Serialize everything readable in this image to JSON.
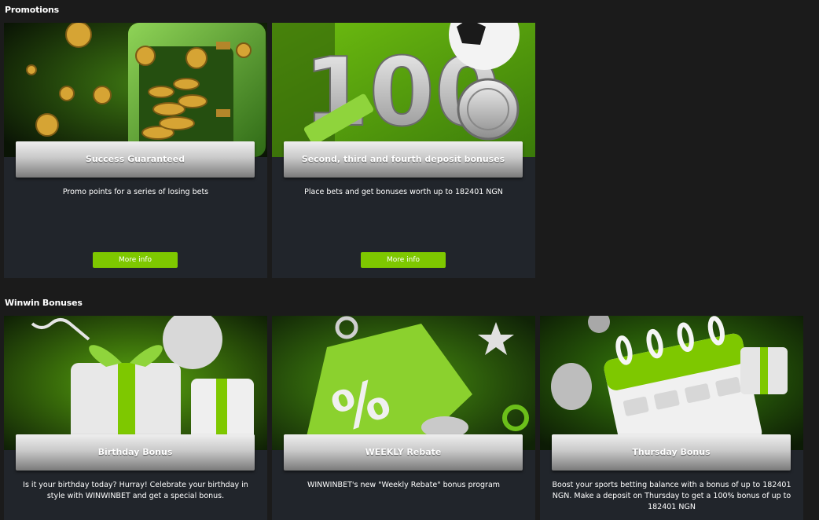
{
  "promotions": {
    "title": "Promotions",
    "cards": [
      {
        "title": "Success Guaranteed",
        "description": "Promo points for a series of losing bets",
        "button": "More info"
      },
      {
        "title": "Second, third and fourth deposit bonuses",
        "description": "Place bets and get bonuses worth up to 182401 NGN",
        "button": "More info"
      }
    ]
  },
  "bonuses": {
    "title": "Winwin Bonuses",
    "cards": [
      {
        "title": "Birthday Bonus",
        "description": "Is it your birthday today? Hurray! Celebrate your birthday in style with WINWINBET and get a special bonus."
      },
      {
        "title": "WEEKLY Rebate",
        "description": "WINWINBET's new \"Weekly Rebate\" bonus program"
      },
      {
        "title": "Thursday Bonus",
        "description": "Boost your sports betting balance with a bonus of up to 182401 NGN. Make a deposit on Thursday to get a 100% bonus of up to 182401 NGN"
      }
    ]
  },
  "banners": {
    "deposit_number": "100"
  },
  "colors": {
    "accent_green": "#7ec800",
    "card_bg": "#21252b",
    "page_bg": "#1b1b1b"
  }
}
